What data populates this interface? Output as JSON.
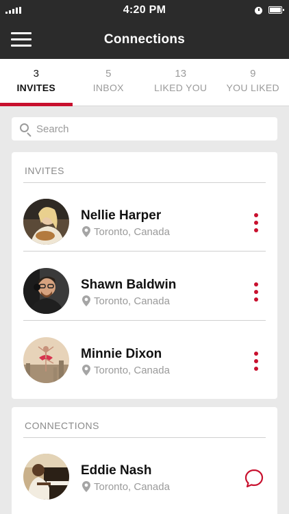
{
  "status": {
    "time": "4:20 PM",
    "icons": [
      "signal-icon",
      "clock-icon",
      "battery-icon"
    ]
  },
  "header": {
    "title": "Connections",
    "menu_icon": "hamburger-menu-icon"
  },
  "tabs": [
    {
      "count": "3",
      "label": "INVITES",
      "active": true
    },
    {
      "count": "5",
      "label": "INBOX",
      "active": false
    },
    {
      "count": "13",
      "label": "LIKED YOU",
      "active": false
    },
    {
      "count": "9",
      "label": "YOU LIKED",
      "active": false
    }
  ],
  "search": {
    "placeholder": "Search",
    "value": "",
    "icon": "search-icon"
  },
  "sections": {
    "invites": {
      "title": "INVITES",
      "people": [
        {
          "name": "Nellie Harper",
          "location": "Toronto, Canada",
          "action_icon": "more-vertical-icon"
        },
        {
          "name": "Shawn Baldwin",
          "location": "Toronto, Canada",
          "action_icon": "more-vertical-icon"
        },
        {
          "name": "Minnie Dixon",
          "location": "Toronto, Canada",
          "action_icon": "more-vertical-icon"
        }
      ]
    },
    "connections": {
      "title": "CONNECTIONS",
      "people": [
        {
          "name": "Eddie Nash",
          "location": "Toronto, Canada",
          "action_icon": "chat-bubble-icon"
        }
      ]
    }
  },
  "colors": {
    "accent": "#c8102e",
    "header_bg": "#2b2b2b",
    "page_bg": "#e9e9e9",
    "muted_text": "#9a9a9a"
  }
}
